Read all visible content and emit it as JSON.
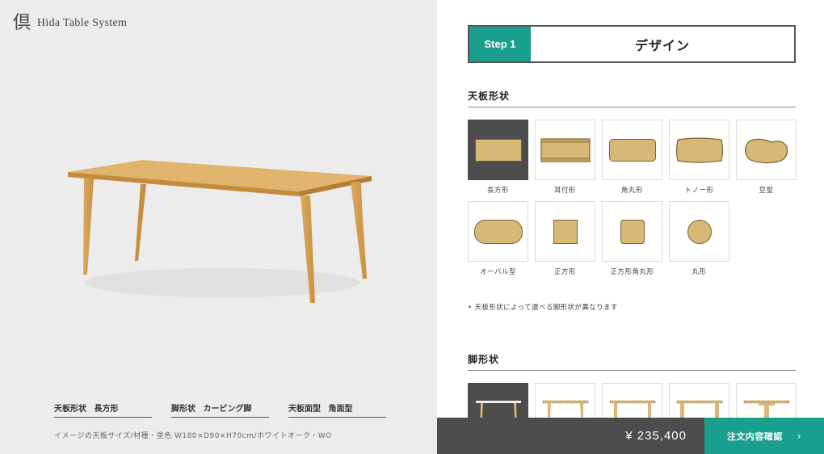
{
  "brand": {
    "mark": "倶",
    "name": "Hida Table System"
  },
  "specs": [
    {
      "label": "天板形状",
      "value": "長方形"
    },
    {
      "label": "脚形状",
      "value": "カービング脚"
    },
    {
      "label": "天板面型",
      "value": "角面型"
    }
  ],
  "caption": "イメージの天板サイズ/材種・塗色 W180×D90×H70cm/ホワイトオーク・WO",
  "step": {
    "number": "Step 1",
    "title": "デザイン"
  },
  "top_shape": {
    "heading": "天板形状",
    "options": [
      {
        "label": "長方形",
        "selected": true
      },
      {
        "label": "耳付形",
        "selected": false
      },
      {
        "label": "角丸形",
        "selected": false
      },
      {
        "label": "トノー形",
        "selected": false
      },
      {
        "label": "豆型",
        "selected": false
      },
      {
        "label": "オーバル型",
        "selected": false
      },
      {
        "label": "正方形",
        "selected": false
      },
      {
        "label": "正方形角丸形",
        "selected": false
      },
      {
        "label": "丸形",
        "selected": false
      }
    ],
    "note": "• 天板形状によって選べる脚形状が異なります"
  },
  "leg_shape": {
    "heading": "脚形状"
  },
  "footer": {
    "price": "¥ 235,400",
    "confirm_label": "注文内容確認",
    "chevron": "›"
  },
  "colors": {
    "accent": "#1a9f8f",
    "dark": "#4d4d4d",
    "wood": "#d8b877"
  }
}
